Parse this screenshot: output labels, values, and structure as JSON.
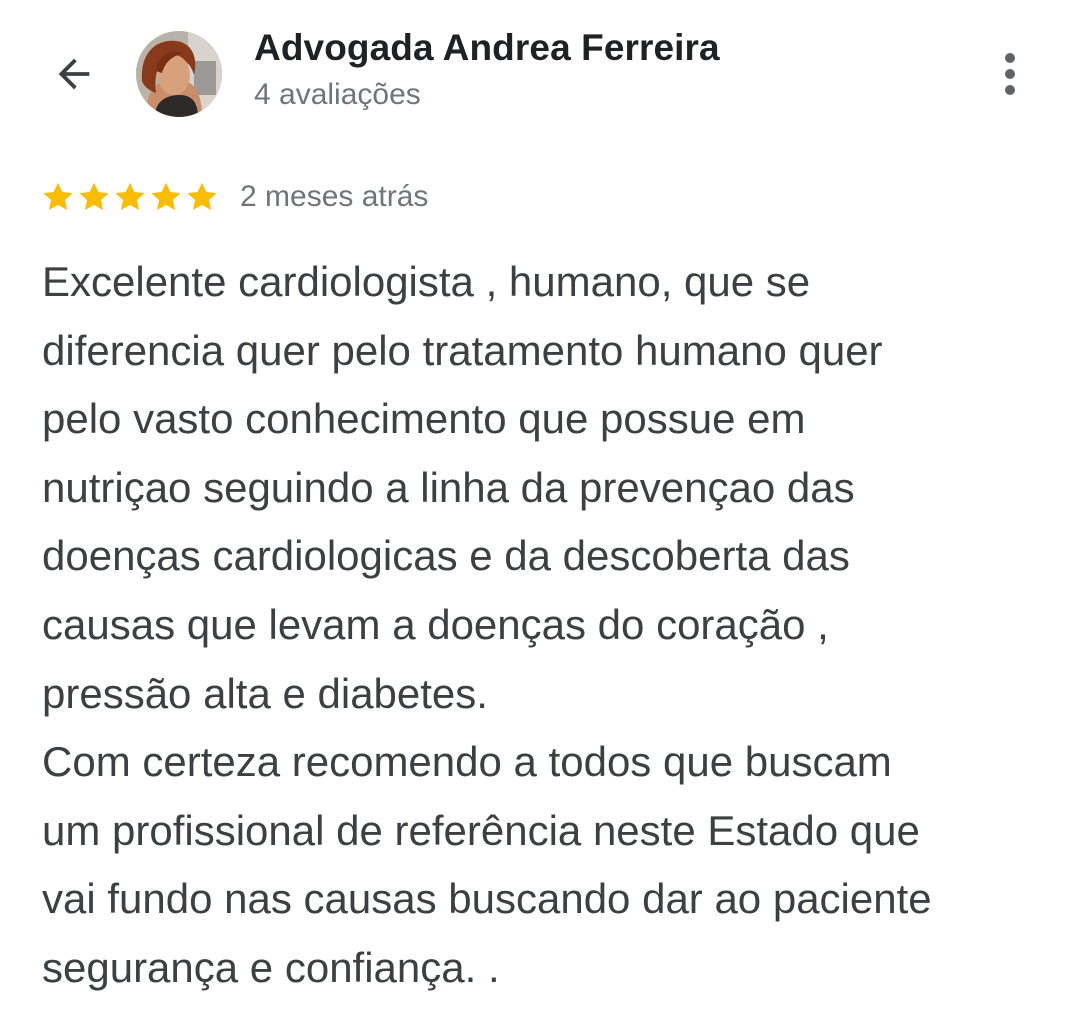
{
  "header": {
    "back_icon": "arrow-back-icon",
    "reviewer_name": "Advogada Andrea Ferreira",
    "review_count": "4 avaliações",
    "more_icon": "more-vert-icon"
  },
  "review": {
    "rating": 5,
    "rating_max": 5,
    "star_color": "#fbbc04",
    "date": "2 meses atrás",
    "lines": [
      "Excelente cardiologista , humano, que se",
      "diferencia quer pelo tratamento humano quer",
      "pelo vasto conhecimento que possue em",
      "nutriçao seguindo a linha da prevençao das",
      "doenças cardiologicas e da descoberta das",
      "causas que levam a doenças do coração ,",
      "pressão alta e diabetes.",
      "Com certeza recomendo a todos que buscam",
      "um profissional de referência neste Estado que",
      "vai fundo nas causas buscando dar ao paciente",
      "segurança e confiança. ."
    ]
  }
}
